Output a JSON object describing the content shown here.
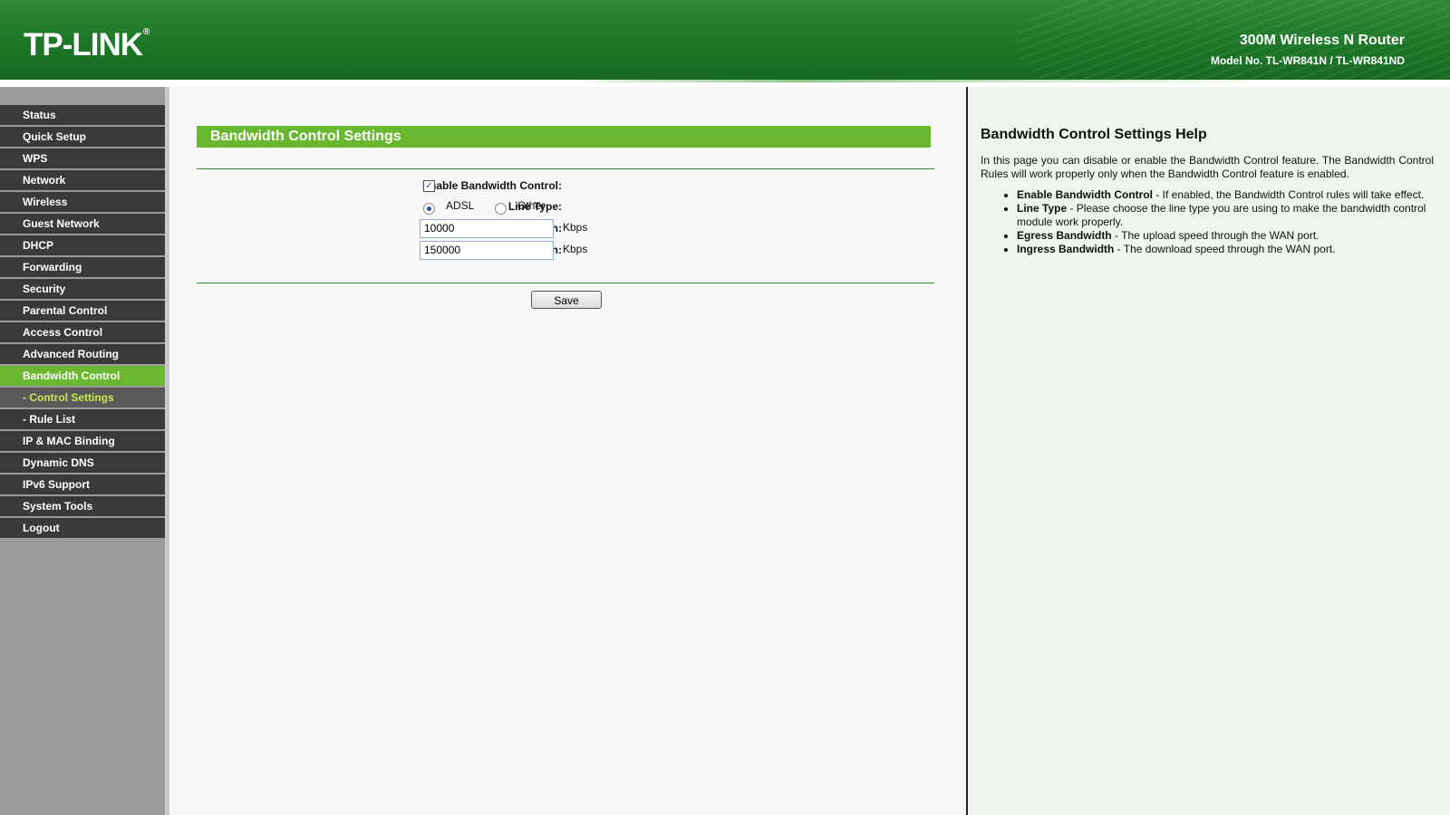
{
  "header": {
    "logo": "TP-LINK",
    "logo_mark": "®",
    "product_title": "300M Wireless N Router",
    "model_no": "Model No. TL-WR841N / TL-WR841ND"
  },
  "sidebar": {
    "items": [
      {
        "label": "Status"
      },
      {
        "label": "Quick Setup"
      },
      {
        "label": "WPS"
      },
      {
        "label": "Network"
      },
      {
        "label": "Wireless"
      },
      {
        "label": "Guest Network"
      },
      {
        "label": "DHCP"
      },
      {
        "label": "Forwarding"
      },
      {
        "label": "Security"
      },
      {
        "label": "Parental Control"
      },
      {
        "label": "Access Control"
      },
      {
        "label": "Advanced Routing"
      },
      {
        "label": "Bandwidth Control"
      },
      {
        "label": "- Control Settings"
      },
      {
        "label": "- Rule List"
      },
      {
        "label": "IP & MAC Binding"
      },
      {
        "label": "Dynamic DNS"
      },
      {
        "label": "IPv6 Support"
      },
      {
        "label": "System Tools"
      },
      {
        "label": "Logout"
      }
    ]
  },
  "main": {
    "section_title": "Bandwidth Control Settings",
    "enable_label": "Enable Bandwidth Control:",
    "enable_checked": true,
    "line_type_label": "Line Type:",
    "line_type_options": [
      "ADSL",
      "Other"
    ],
    "line_type_selected": "ADSL",
    "egress_label": "Egress Bandwidth:",
    "egress_value": "10000",
    "ingress_label": "Ingress Bandwidth:",
    "ingress_value": "150000",
    "unit": "Kbps",
    "save_label": "Save"
  },
  "help": {
    "title": "Bandwidth Control Settings Help",
    "intro": "In this page you can disable or enable the Bandwidth Control feature. The Bandwidth Control Rules will work properly only when the Bandwidth Control feature is enabled.",
    "items": [
      {
        "term": "Enable Bandwidth Control",
        "desc": " - If enabled, the Bandwidth Control rules will take effect."
      },
      {
        "term": "Line Type",
        "desc": " - Please choose the line type you are using to make the bandwidth control module work properly."
      },
      {
        "term": "Egress Bandwidth",
        "desc": " - The upload speed through the WAN port."
      },
      {
        "term": "Ingress Bandwidth",
        "desc": " - The download speed through the WAN port."
      }
    ]
  },
  "colors": {
    "header_green": "#1f7a2a",
    "accent_green": "#6ab82f",
    "menu_dark": "#3a3a3a",
    "submenu_active_text": "#c7e84f"
  }
}
